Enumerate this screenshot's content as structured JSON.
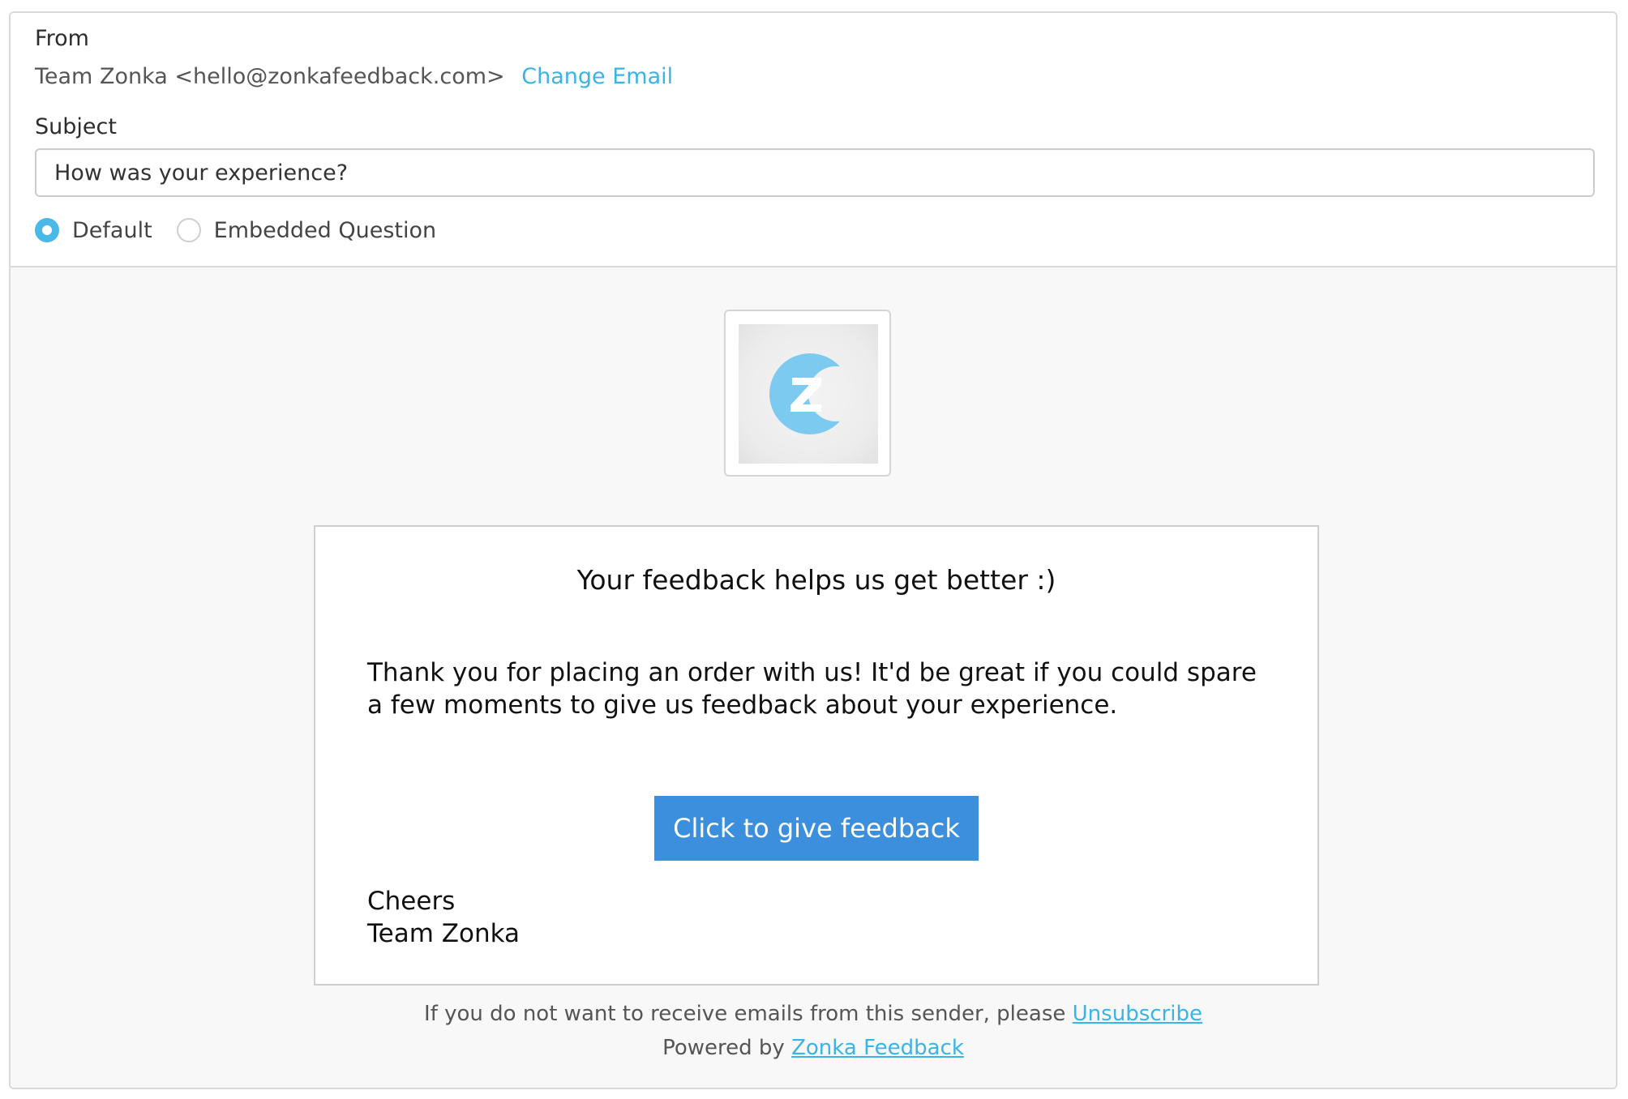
{
  "header": {
    "from_label": "From",
    "from_sender": "Team Zonka <hello@zonkafeedback.com>",
    "change_email_label": "Change Email",
    "subject_label": "Subject",
    "subject_value": "How was your experience?",
    "mode_options": [
      {
        "label": "Default",
        "selected": true
      },
      {
        "label": "Embedded Question",
        "selected": false
      }
    ]
  },
  "preview": {
    "logo": {
      "icon": "zonka-z-logo",
      "color": "#7ccaf0"
    },
    "heading": "Your feedback helps us get better :)",
    "body": "Thank you for placing an order with us! It'd be great if you could spare a few moments to give us feedback about your experience.",
    "cta_label": "Click to give feedback",
    "signoff_line1": "Cheers",
    "signoff_line2": "Team Zonka",
    "footer": {
      "unsubscribe_text": "If you do not want to receive emails from this sender, please",
      "unsubscribe_link": "Unsubscribe",
      "powered_text": "Powered by",
      "powered_link": "Zonka Feedback"
    }
  },
  "colors": {
    "accent": "#3ab4e6",
    "button": "#3c8fdd",
    "radio_selected": "#4ab8e8"
  }
}
